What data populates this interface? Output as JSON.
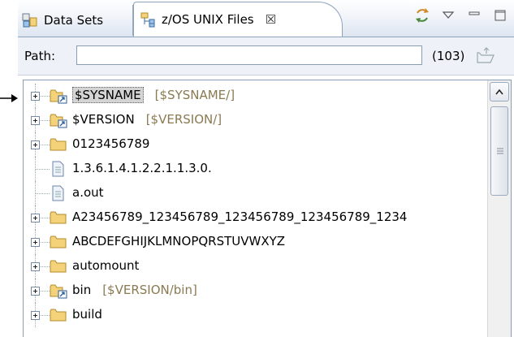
{
  "tabs": [
    {
      "label": "Data Sets",
      "icon": "datasets-icon",
      "active": false
    },
    {
      "label": "z/OS UNIX Files",
      "icon": "unix-files-icon",
      "active": true,
      "close": "☒"
    }
  ],
  "path": {
    "label": "Path:",
    "value": "",
    "count": "(103)"
  },
  "tree": {
    "items": [
      {
        "label": "$SYSNAME",
        "sub": "[$SYSNAME/]",
        "type": "symlink",
        "expandable": true,
        "selected": true
      },
      {
        "label": "$VERSION",
        "sub": "[$VERSION/]",
        "type": "symlink",
        "expandable": true
      },
      {
        "label": "0123456789",
        "type": "folder",
        "expandable": true
      },
      {
        "label": "1.3.6.1.4.1.2.2.1.1.3.0.",
        "type": "file",
        "expandable": false
      },
      {
        "label": "a.out",
        "type": "file",
        "expandable": false
      },
      {
        "label": "A23456789_123456789_123456789_123456789_1234",
        "type": "folder",
        "expandable": true
      },
      {
        "label": "ABCDEFGHIJKLMNOPQRSTUVWXYZ",
        "type": "folder",
        "expandable": true
      },
      {
        "label": "automount",
        "type": "folder",
        "expandable": true
      },
      {
        "label": "bin",
        "sub": "[$VERSION/bin]",
        "type": "symlink",
        "expandable": true
      },
      {
        "label": "build",
        "type": "folder",
        "expandable": true
      }
    ]
  },
  "colors": {
    "link_target": "#8a7a52",
    "folder": "#f3d27a",
    "selection": "#d4d4d4"
  }
}
